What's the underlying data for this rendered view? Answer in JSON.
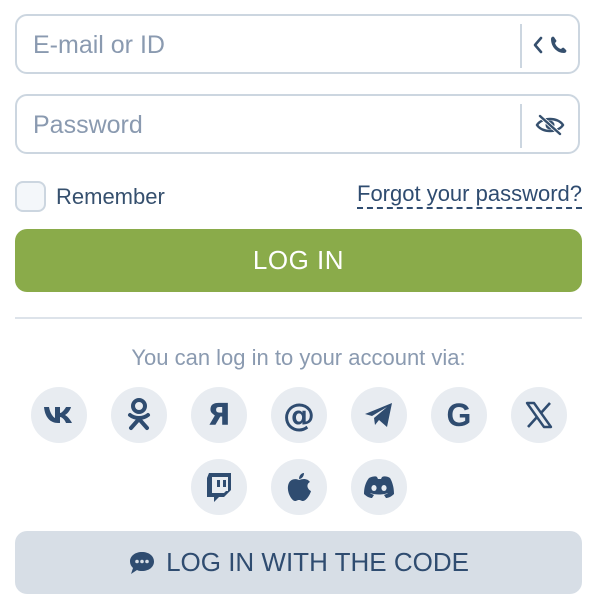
{
  "login_form": {
    "email_placeholder": "E-mail or ID",
    "password_placeholder": "Password",
    "remember_label": "Remember",
    "forgot_link": "Forgot your password?",
    "login_button": "LOG IN"
  },
  "social": {
    "prompt": "You can log in to your account via:",
    "providers": [
      {
        "name": "VK",
        "icon": "vk-icon"
      },
      {
        "name": "Odnoklassniki",
        "icon": "ok-icon"
      },
      {
        "name": "Yandex",
        "icon": "yandex-icon"
      },
      {
        "name": "Mail.ru",
        "icon": "at-icon"
      },
      {
        "name": "Telegram",
        "icon": "telegram-icon"
      },
      {
        "name": "Google",
        "icon": "google-icon"
      },
      {
        "name": "X",
        "icon": "x-icon"
      },
      {
        "name": "Twitch",
        "icon": "twitch-icon"
      },
      {
        "name": "Apple",
        "icon": "apple-icon"
      },
      {
        "name": "Discord",
        "icon": "discord-icon"
      }
    ]
  },
  "code_login": {
    "label": "LOG IN WITH THE CODE"
  },
  "colors": {
    "primary_green": "#8aab4a",
    "text_dark": "#2f4c70",
    "icon_bg": "#e8ecf1",
    "border": "#ccd6e0"
  }
}
